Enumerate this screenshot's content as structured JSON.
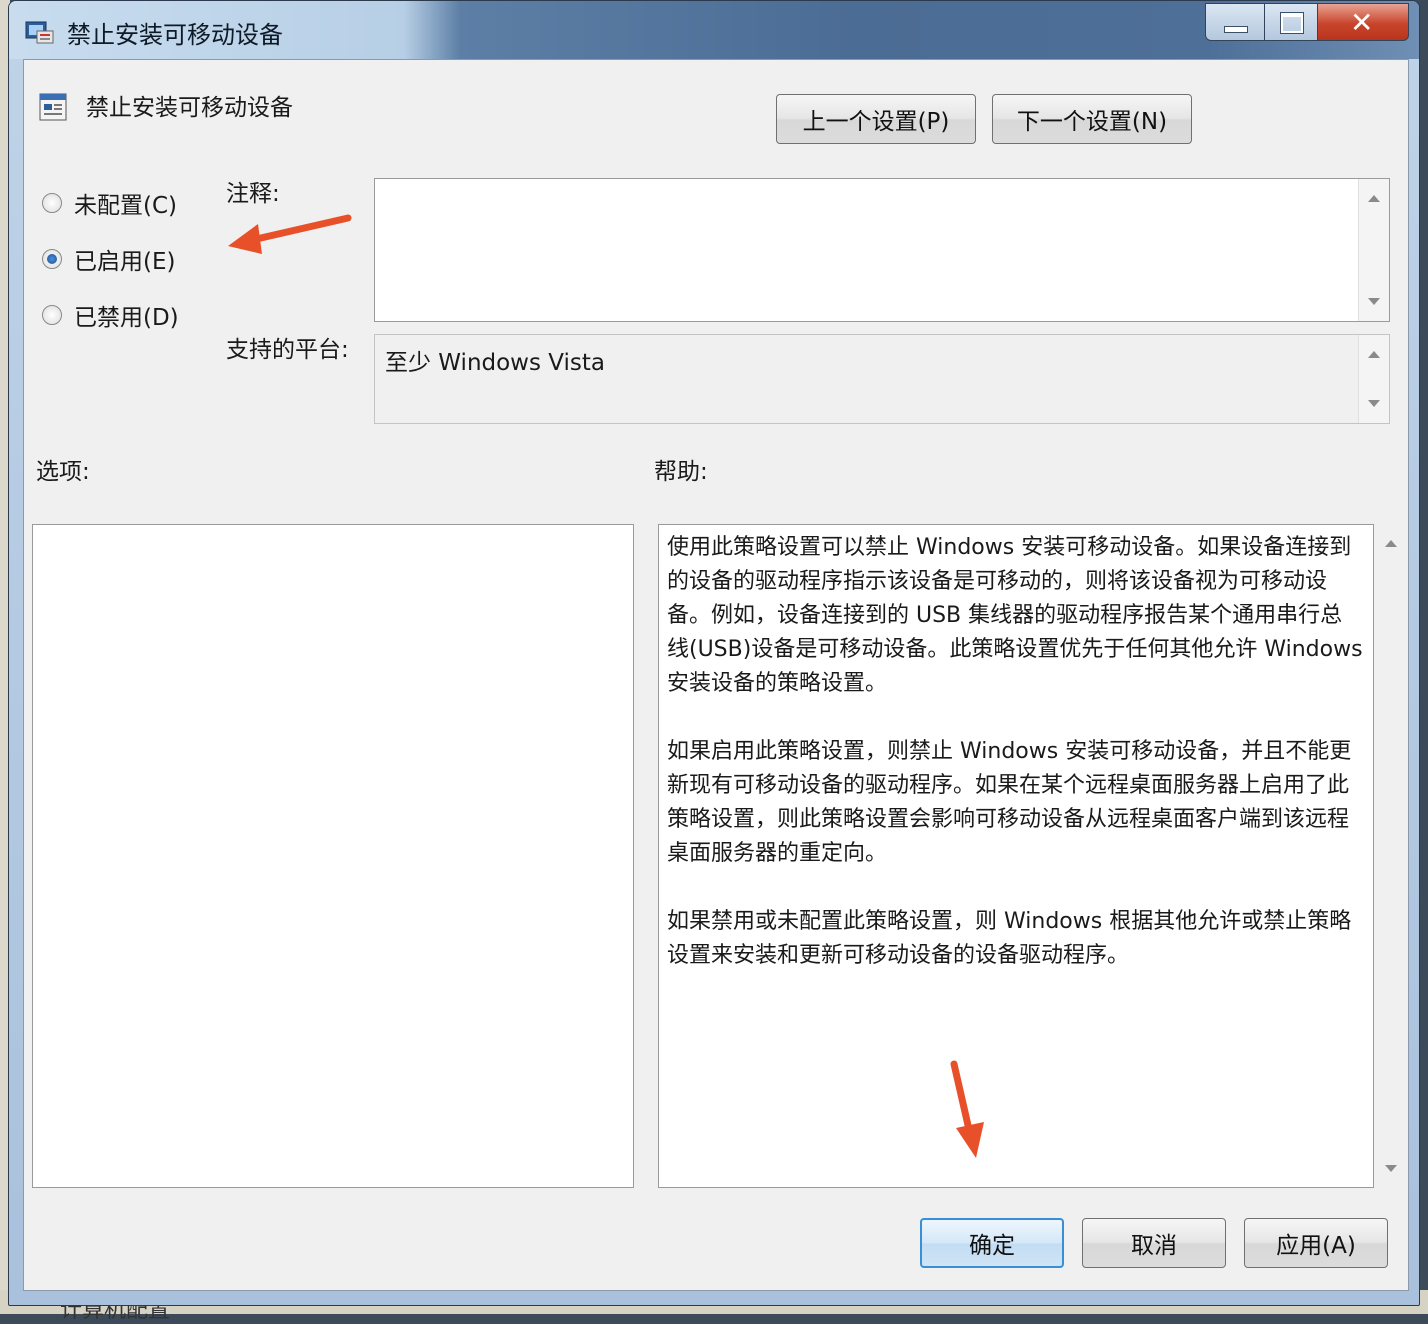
{
  "window": {
    "title": "禁止安装可移动设备"
  },
  "policy": {
    "title": "禁止安装可移动设备"
  },
  "nav": {
    "prev_label": "上一个设置(P)",
    "next_label": "下一个设置(N)"
  },
  "state": {
    "options": [
      {
        "label": "未配置(C)",
        "checked": false
      },
      {
        "label": "已启用(E)",
        "checked": true
      },
      {
        "label": "已禁用(D)",
        "checked": false
      }
    ]
  },
  "comment": {
    "label": "注释:",
    "value": ""
  },
  "platform": {
    "label": "支持的平台:",
    "value": "至少 Windows Vista"
  },
  "options_pane": {
    "label": "选项:"
  },
  "help_pane": {
    "label": "帮助:",
    "text": "使用此策略设置可以禁止 Windows 安装可移动设备。如果设备连接到的设备的驱动程序指示该设备是可移动的，则将该设备视为可移动设备。例如，设备连接到的 USB 集线器的驱动程序报告某个通用串行总线(USB)设备是可移动设备。此策略设置优先于任何其他允许 Windows 安装设备的策略设置。\n\n如果启用此策略设置，则禁止 Windows 安装可移动设备，并且不能更新现有可移动设备的驱动程序。如果在某个远程桌面服务器上启用了此策略设置，则此策略设置会影响可移动设备从远程桌面客户端到该远程桌面服务器的重定向。\n\n如果禁用或未配置此策略设置，则 Windows 根据其他允许或禁止策略设置来安装和更新可移动设备的设备驱动程序。"
  },
  "footer": {
    "ok_label": "确定",
    "cancel_label": "取消",
    "apply_label": "应用(A)"
  },
  "backdrop": {
    "behind_text": "计算机配置"
  },
  "colors": {
    "annotation_arrow": "#e8502a",
    "default_button_border": "#3a8ed6"
  }
}
